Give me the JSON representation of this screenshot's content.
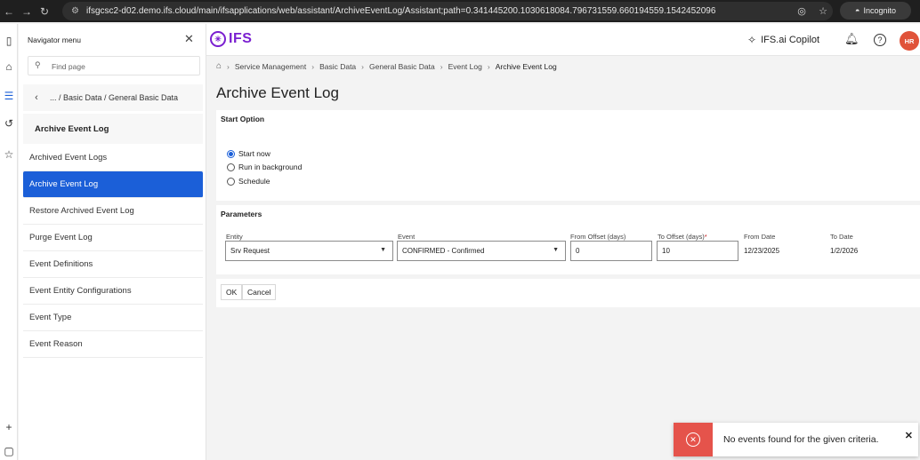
{
  "browser": {
    "url": "ifsgcsc2-d02.demo.ifs.cloud/main/ifsapplications/web/assistant/ArchiveEventLog/Assistant;path=0.341445200.1030618084.796731559.660194559.1542452096",
    "incognito_label": "Incognito"
  },
  "navigator": {
    "title": "Navigator menu",
    "search_placeholder": "Find page",
    "back_crumb": "... / Basic Data / General Basic Data",
    "heading": "Archive Event Log",
    "items": [
      {
        "label": "Archived Event Logs",
        "active": false
      },
      {
        "label": "Archive Event Log",
        "active": true
      },
      {
        "label": "Restore Archived Event Log",
        "active": false
      },
      {
        "label": "Purge Event Log",
        "active": false
      },
      {
        "label": "Event Definitions",
        "active": false
      },
      {
        "label": "Event Entity Configurations",
        "active": false
      },
      {
        "label": "Event Type",
        "active": false
      },
      {
        "label": "Event Reason",
        "active": false
      }
    ]
  },
  "header": {
    "logo_text": "IFS",
    "copilot_label": "IFS.ai Copilot",
    "avatar_initials": "HR"
  },
  "breadcrumb": [
    "Service Management",
    "Basic Data",
    "General Basic Data",
    "Event Log",
    "Archive Event Log"
  ],
  "page_title": "Archive Event Log",
  "start_option": {
    "title": "Start Option",
    "options": [
      {
        "label": "Start now",
        "checked": true
      },
      {
        "label": "Run in background",
        "checked": false
      },
      {
        "label": "Schedule",
        "checked": false
      }
    ]
  },
  "parameters": {
    "title": "Parameters",
    "entity_label": "Entity",
    "entity_value": "Srv Request",
    "event_label": "Event",
    "event_value": "CONFIRMED - Confirmed",
    "from_offset_label": "From Offset (days)",
    "from_offset_value": "0",
    "to_offset_label": "To Offset (days)",
    "to_offset_value": "10",
    "from_date_label": "From Date",
    "from_date_value": "12/23/2025",
    "to_date_label": "To Date",
    "to_date_value": "1/2/2026"
  },
  "actions": {
    "ok": "OK",
    "cancel": "Cancel"
  },
  "toast": {
    "message": "No events found for the given criteria."
  },
  "colors": {
    "accent": "#1b5fd8",
    "brand": "#7a1fd0",
    "error": "#e5534b",
    "avatar": "#e0533a"
  }
}
